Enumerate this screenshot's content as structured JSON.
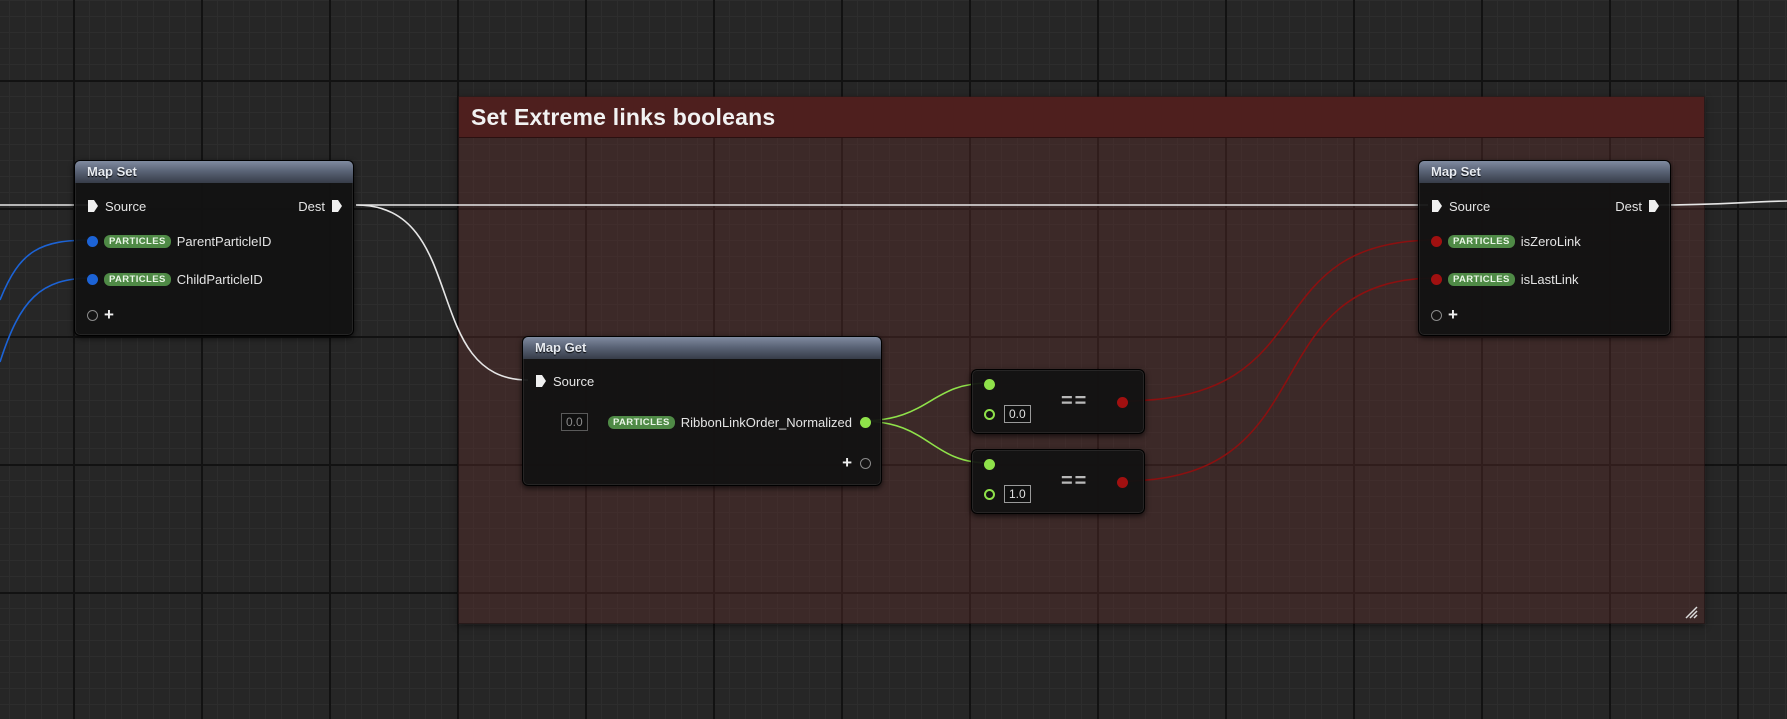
{
  "comment": {
    "title": "Set Extreme links booleans"
  },
  "tag_label": "PARTICLES",
  "map_set_left": {
    "title": "Map Set",
    "source_label": "Source",
    "dest_label": "Dest",
    "params": [
      "ParentParticleID",
      "ChildParticleID"
    ],
    "add_label": "+"
  },
  "map_get": {
    "title": "Map Get",
    "source_label": "Source",
    "default_value": "0.0",
    "param": "RibbonLinkOrder_Normalized",
    "add_label": "+"
  },
  "equals_nodes": [
    {
      "value": "0.0",
      "op": "=="
    },
    {
      "value": "1.0",
      "op": "=="
    }
  ],
  "map_set_right": {
    "title": "Map Set",
    "source_label": "Source",
    "dest_label": "Dest",
    "params": [
      "isZeroLink",
      "isLastLink"
    ],
    "add_label": "+"
  },
  "colors": {
    "background": "#262626",
    "comment_header": "#4e1f1e",
    "node_header": "#5b6477",
    "tag": "#4f8a46",
    "pin_int": "#1c63d6",
    "pin_bool": "#a11010",
    "pin_float": "#8fe24a",
    "exec_wire": "#e6e6e6"
  }
}
